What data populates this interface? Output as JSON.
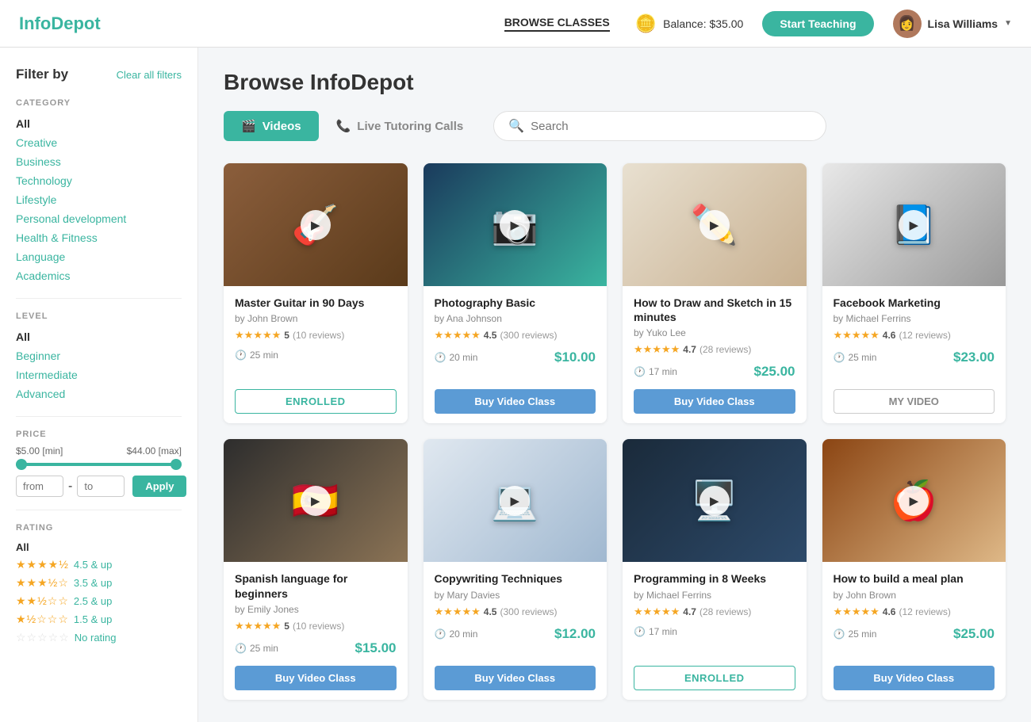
{
  "brand": "InfoDepot",
  "nav": {
    "browse_label": "BROWSE CLASSES",
    "balance_label": "Balance: $35.00",
    "start_teaching_label": "Start Teaching",
    "user_name": "Lisa Williams"
  },
  "sidebar": {
    "filter_title": "Filter by",
    "clear_label": "Clear all filters",
    "category_title": "CATEGORY",
    "categories": [
      {
        "label": "All",
        "active": true
      },
      {
        "label": "Creative"
      },
      {
        "label": "Business"
      },
      {
        "label": "Technology"
      },
      {
        "label": "Lifestyle"
      },
      {
        "label": "Personal development"
      },
      {
        "label": "Health & Fitness"
      },
      {
        "label": "Language"
      },
      {
        "label": "Academics"
      }
    ],
    "level_title": "LEVEL",
    "levels": [
      {
        "label": "All",
        "active": true
      },
      {
        "label": "Beginner"
      },
      {
        "label": "Intermediate"
      },
      {
        "label": "Advanced"
      }
    ],
    "price_title": "PRICE",
    "price_min_label": "$5.00 [min]",
    "price_max_label": "$44.00 [max]",
    "price_from_placeholder": "from",
    "price_to_placeholder": "to",
    "price_apply_label": "Apply",
    "rating_title": "RATING",
    "ratings": [
      {
        "label": "All",
        "active": true,
        "stars": 0
      },
      {
        "label": "4.5 & up",
        "active": false,
        "stars": 4.5
      },
      {
        "label": "3.5 & up",
        "active": false,
        "stars": 3.5
      },
      {
        "label": "2.5 & up",
        "active": false,
        "stars": 2.5
      },
      {
        "label": "1.5 & up",
        "active": false,
        "stars": 1.5
      },
      {
        "label": "No rating",
        "active": false,
        "stars": 0
      }
    ]
  },
  "main": {
    "title": "Browse InfoDepot",
    "tabs": [
      {
        "label": "Videos",
        "active": true
      },
      {
        "label": "Live Tutoring Calls",
        "active": false
      }
    ],
    "search_placeholder": "Search"
  },
  "courses": [
    {
      "id": 1,
      "title": "Master Guitar in 90 Days",
      "author": "by John Brown",
      "rating": 5,
      "rating_display": "5",
      "reviews": "(10 reviews)",
      "duration": "25 min",
      "price": null,
      "button_type": "enrolled",
      "button_label": "ENROLLED",
      "thumb_class": "thumb-guitar",
      "thumb_emoji": "🎸"
    },
    {
      "id": 2,
      "title": "Photography Basic",
      "author": "by Ana Johnson",
      "rating": 4.5,
      "rating_display": "4.5",
      "reviews": "(300 reviews)",
      "duration": "20 min",
      "price": "$10.00",
      "button_type": "buy",
      "button_label": "Buy Video Class",
      "thumb_class": "thumb-photo",
      "thumb_emoji": "📷"
    },
    {
      "id": 3,
      "title": "How to Draw and Sketch in 15 minutes",
      "author": "by Yuko Lee",
      "rating": 4.7,
      "rating_display": "4.7",
      "reviews": "(28 reviews)",
      "duration": "17 min",
      "price": "$25.00",
      "button_type": "buy",
      "button_label": "Buy Video Class",
      "thumb_class": "thumb-draw",
      "thumb_emoji": "✏️"
    },
    {
      "id": 4,
      "title": "Facebook Marketing",
      "author": "by Michael Ferrins",
      "rating": 4.6,
      "rating_display": "4.6",
      "reviews": "(12 reviews)",
      "duration": "25 min",
      "price": "$23.00",
      "button_type": "myvideo",
      "button_label": "MY VIDEO",
      "thumb_class": "thumb-fb",
      "thumb_emoji": "📘"
    },
    {
      "id": 5,
      "title": "Spanish language for beginners",
      "author": "by Emily Jones",
      "rating": 5,
      "rating_display": "5",
      "reviews": "(10 reviews)",
      "duration": "25 min",
      "price": "$15.00",
      "button_type": "buy",
      "button_label": "Buy Video Class",
      "thumb_class": "thumb-spanish",
      "thumb_emoji": "🇪🇸"
    },
    {
      "id": 6,
      "title": "Copywriting Techniques",
      "author": "by Mary Davies",
      "rating": 4.5,
      "rating_display": "4.5",
      "reviews": "(300 reviews)",
      "duration": "20 min",
      "price": "$12.00",
      "button_type": "buy",
      "button_label": "Buy Video Class",
      "thumb_class": "thumb-copy",
      "thumb_emoji": "💻"
    },
    {
      "id": 7,
      "title": "Programming in 8 Weeks",
      "author": "by Michael Ferrins",
      "rating": 4.7,
      "rating_display": "4.7",
      "reviews": "(28 reviews)",
      "duration": "17 min",
      "price": null,
      "button_type": "enrolled",
      "button_label": "ENROLLED",
      "thumb_class": "thumb-prog",
      "thumb_emoji": "🖥️"
    },
    {
      "id": 8,
      "title": "How to build a meal plan",
      "author": "by John Brown",
      "rating": 4.6,
      "rating_display": "4.6",
      "reviews": "(12 reviews)",
      "duration": "25 min",
      "price": "$25.00",
      "button_type": "buy",
      "button_label": "Buy Video Class",
      "thumb_class": "thumb-meal",
      "thumb_emoji": "🍎"
    }
  ]
}
